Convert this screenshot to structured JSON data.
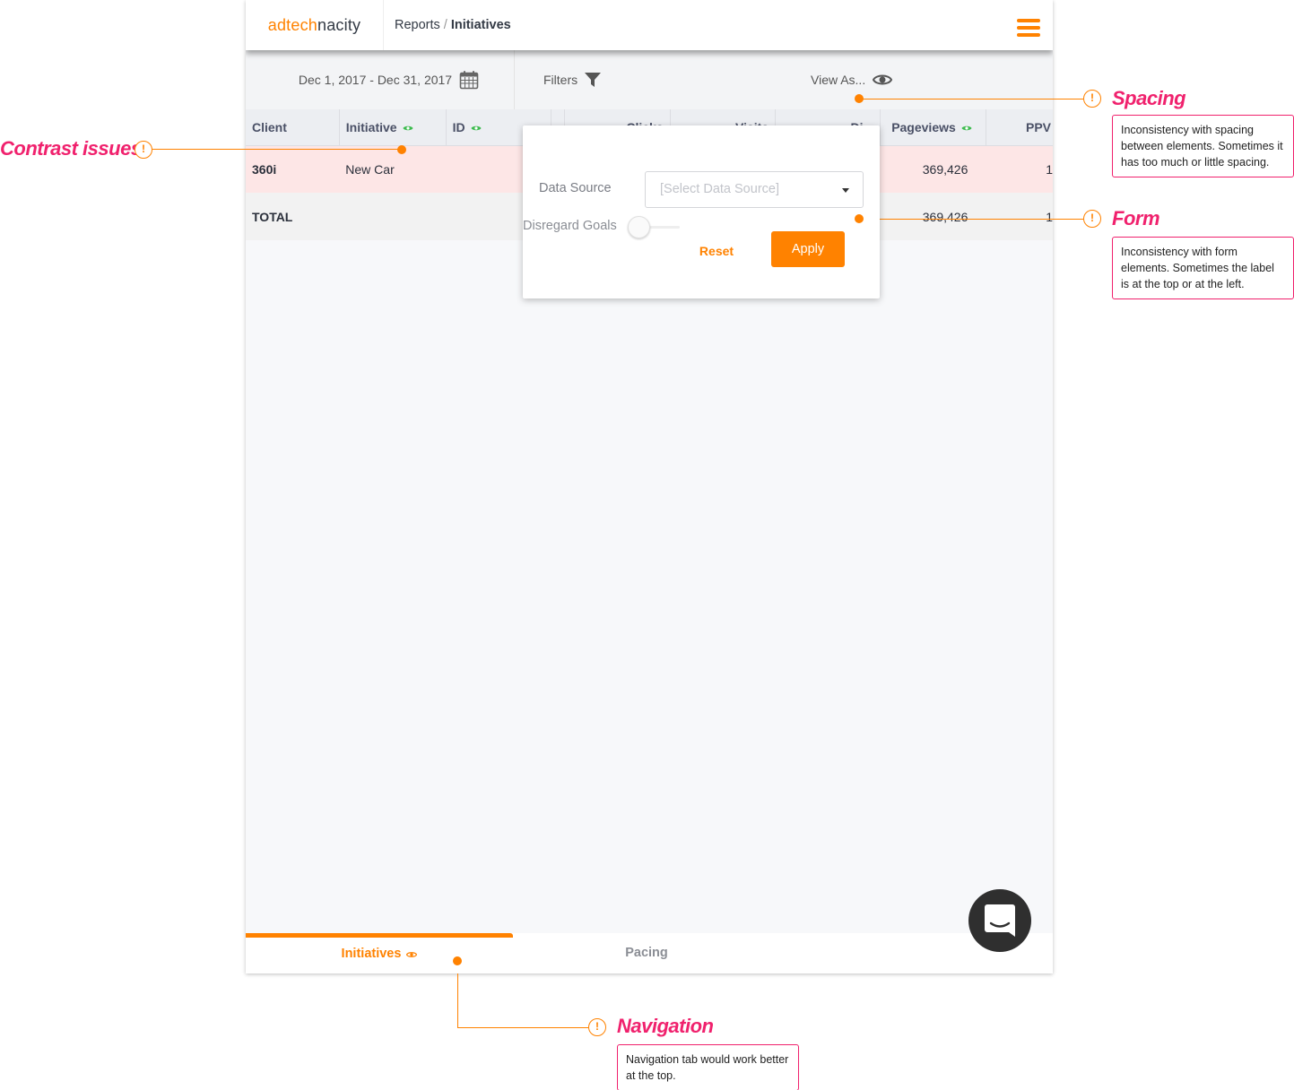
{
  "app": {
    "logo_part1": "adtech",
    "logo_part2": "nacity",
    "breadcrumb": {
      "parent": "Reports",
      "separator": "/",
      "current": "Initiatives"
    },
    "menu_icon": "hamburger-menu-icon"
  },
  "toolbar": {
    "date_range": "Dec 1, 2017 - Dec 31, 2017",
    "date_icon": "calendar-icon",
    "filters_label": "Filters",
    "filters_icon": "funnel-icon",
    "view_as_label": "View As...",
    "view_as_icon": "eye-icon"
  },
  "table": {
    "columns": [
      {
        "label": "Client",
        "eye": false
      },
      {
        "label": "Initiative",
        "eye": true
      },
      {
        "label": "ID",
        "eye": true
      },
      {
        "label": "",
        "eye": false
      },
      {
        "label": "Clicks",
        "eye": false
      },
      {
        "label": "Visits",
        "eye": false
      },
      {
        "label": "Di...",
        "eye": false
      },
      {
        "label": "Pageviews",
        "eye": true
      },
      {
        "label": "PPV",
        "eye": false
      }
    ],
    "rows": [
      {
        "client": "360i",
        "initiative": "New Car",
        "pageviews": "369,426",
        "ppv": "1"
      }
    ],
    "total": {
      "label": "TOTAL",
      "pageviews": "369,426",
      "ppv": "1"
    }
  },
  "filter_popup": {
    "data_source_label": "Data Source",
    "data_source_placeholder": "[Select Data Source]",
    "disregard_goals_label": "Disregard Goals",
    "disregard_goals_on": false,
    "reset_label": "Reset",
    "apply_label": "Apply"
  },
  "bottom_nav": {
    "tabs": [
      {
        "label": "Initiatives",
        "active": true
      },
      {
        "label": "Pacing",
        "active": false
      }
    ]
  },
  "annotations": {
    "contrast": {
      "title": "Contrast issues"
    },
    "spacing": {
      "title": "Spacing",
      "text": "Inconsistency with spacing between elements. Sometimes it has too much or little spacing."
    },
    "form": {
      "title": "Form",
      "text": "Inconsistency with form elements. Sometimes the label is at the top or at the left."
    },
    "navigation": {
      "title": "Navigation",
      "text": "Navigation tab would work better at the top."
    },
    "warn_glyph": "!"
  },
  "colors": {
    "brand": "#ff8200",
    "annotation": "#f0216d",
    "highlight_row": "#fde6e6",
    "eye_green": "#3dbb4f"
  }
}
